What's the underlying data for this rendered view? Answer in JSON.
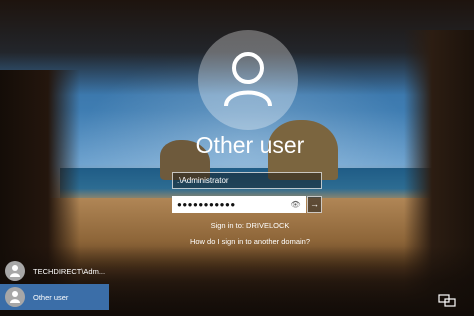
{
  "login": {
    "username": "Other user",
    "user_field_value": ".\\Administrator",
    "password_mask": "●●●●●●●●●●●",
    "sign_in_to": "Sign in to: DRIVELOCK",
    "help_link": "How do I sign in to another domain?"
  },
  "users": [
    {
      "label": "TECHDIRECT\\Adm..."
    },
    {
      "label": "Other user"
    }
  ],
  "icons": {
    "avatar": "user-icon",
    "submit": "arrow-right-icon",
    "reveal": "eye-icon",
    "network": "network-icon"
  }
}
